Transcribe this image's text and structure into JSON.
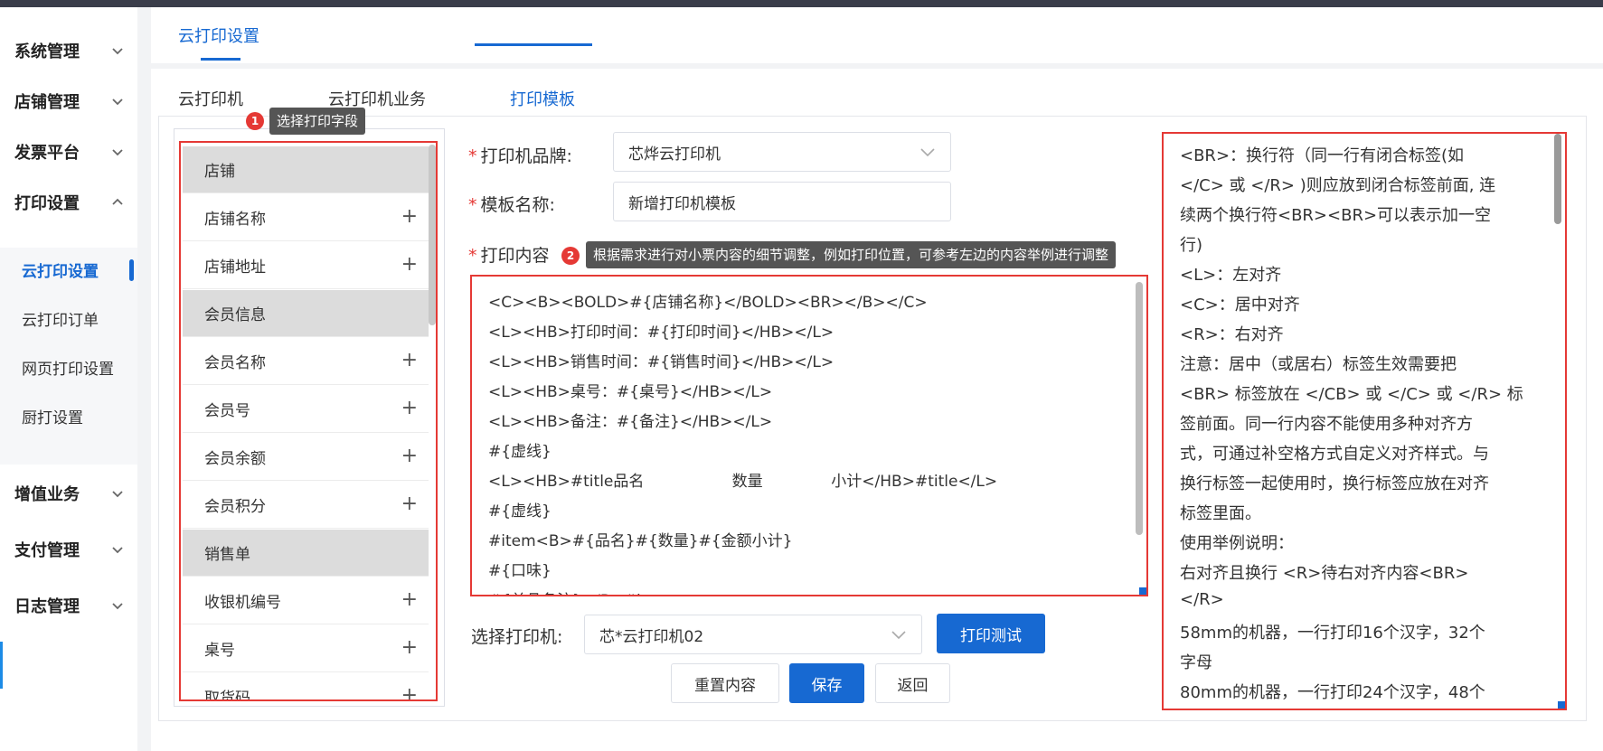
{
  "sidebar": {
    "groups": [
      {
        "label": "系统管理"
      },
      {
        "label": "店铺管理"
      },
      {
        "label": "发票平台"
      },
      {
        "label": "打印设置"
      },
      {
        "label": "增值业务"
      },
      {
        "label": "支付管理"
      },
      {
        "label": "日志管理"
      }
    ],
    "sub_items": [
      {
        "label": "云打印设置"
      },
      {
        "label": "云打印订单"
      },
      {
        "label": "网页打印设置"
      },
      {
        "label": "厨打设置"
      }
    ]
  },
  "header": {
    "tab": "云打印设置"
  },
  "subtabs": [
    {
      "label": "云打印机"
    },
    {
      "label": "云打印机业务"
    },
    {
      "label": "打印模板"
    }
  ],
  "tooltips": {
    "t1_badge": "1",
    "t1_text": "选择打印字段",
    "t2_badge": "2",
    "t2_text": "根据需求进行对小票内容的细节调整，例如打印位置，可参考左边的内容举例进行调整"
  },
  "fields": [
    {
      "label": "店铺",
      "group": true
    },
    {
      "label": "店铺名称",
      "plus": "+"
    },
    {
      "label": "店铺地址",
      "plus": "+"
    },
    {
      "label": "会员信息",
      "group": true
    },
    {
      "label": "会员名称",
      "plus": "+"
    },
    {
      "label": "会员号",
      "plus": "+"
    },
    {
      "label": "会员余额",
      "plus": "+"
    },
    {
      "label": "会员积分",
      "plus": "+"
    },
    {
      "label": "销售单",
      "group": true
    },
    {
      "label": "收银机编号",
      "plus": "+"
    },
    {
      "label": "桌号",
      "plus": "+"
    },
    {
      "label": "取货码",
      "plus": "+"
    }
  ],
  "form": {
    "brand_label": "打印机品牌:",
    "brand_value": "芯烨云打印机",
    "name_label": "模板名称:",
    "name_value": "新增打印机模板",
    "content_label": "打印内容",
    "required_mark": "*",
    "printer_label": "选择打印机:",
    "printer_value": "芯*云打印机02"
  },
  "editor_lines": [
    "<C><B><BOLD>#{店铺名称}</BOLD><BR></B></C>",
    "<L><HB>打印时间：#{打印时间}</HB></L>",
    "<L><HB>销售时间：#{销售时间}</HB></L>",
    "<L><HB>桌号：#{桌号}</HB></L>",
    "<L><HB>备注：#{备注}</HB></L>",
    "#{虚线}",
    "<L><HB>#title品名                  数量              小计</HB>#title</L>",
    "#{虚线}",
    "#item<B>#{品名}#{数量}#{金额小计}",
    "#{口味}",
    "#{单品备注}</B>#item"
  ],
  "buttons": {
    "print_test": "打印测试",
    "reset": "重置内容",
    "save": "保存",
    "back": "返回"
  },
  "help_lines": [
    "<BR>：换行符（同一行有闭合标签(如",
    "</C> 或 </R> )则应放到闭合标签前面, 连",
    "续两个换行符<BR><BR>可以表示加一空",
    "行)",
    "<L>：左对齐",
    "<C>：居中对齐",
    "<R>：右对齐",
    "注意：居中（或居右）标签生效需要把",
    "<BR> 标签放在 </CB> 或 </C> 或 </R> 标",
    "签前面。同一行内容不能使用多种对齐方",
    "式，可通过补空格方式自定义对齐样式。与",
    "换行标签一起使用时，换行标签应放在对齐",
    "标签里面。",
    "使用举例说明：",
    "   右对齐且换行  <R>待右对齐内容<BR>",
    "</R>",
    "   58mm的机器，一行打印16个汉字，32个",
    "字母",
    "   80mm的机器，一行打印24个汉字，48个"
  ],
  "colors": {
    "accent": "#1769d2",
    "highlight": "#e53935"
  }
}
